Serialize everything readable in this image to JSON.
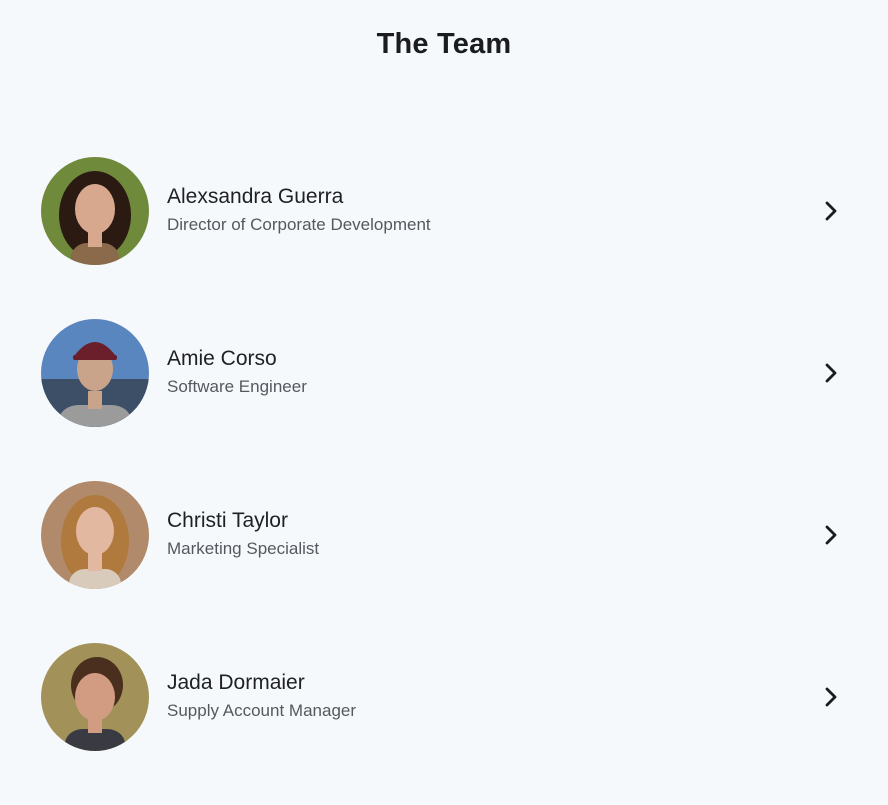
{
  "header": {
    "title": "The Team"
  },
  "team": [
    {
      "name": "Alexsandra Guerra",
      "role": "Director of Corporate Development",
      "avatar": {
        "bg": "#6f8a3a",
        "hair": "#2a1a12",
        "skin": "#d8a88e",
        "shirt": "#8a6a4a"
      }
    },
    {
      "name": "Amie Corso",
      "role": "Software Engineer",
      "avatar": {
        "bg": "#5a86c0",
        "hair": "#6a1f2a",
        "skin": "#c9a48a",
        "shirt": "#9b9b9b"
      }
    },
    {
      "name": "Christi Taylor",
      "role": "Marketing Specialist",
      "avatar": {
        "bg": "#b08a6a",
        "hair": "#b07a3e",
        "skin": "#e3b8a0",
        "shirt": "#d9cbbb"
      }
    },
    {
      "name": "Jada Dormaier",
      "role": "Supply Account Manager",
      "avatar": {
        "bg": "#a2925a",
        "hair": "#4a2f1e",
        "skin": "#d29c82",
        "shirt": "#3a3a42"
      }
    }
  ],
  "icons": {
    "row_action": "chevron-right-icon"
  }
}
